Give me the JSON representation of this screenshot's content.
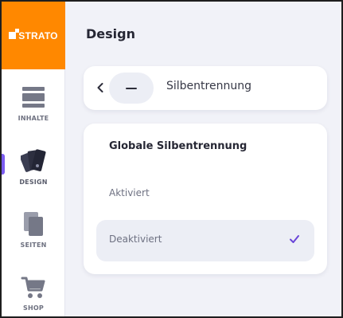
{
  "brand": {
    "name": "STRATO",
    "color": "#ff8800"
  },
  "sidebar": {
    "items": [
      {
        "label": "INHALTE",
        "icon": "content-blocks-icon",
        "active": false
      },
      {
        "label": "DESIGN",
        "icon": "design-swatches-icon",
        "active": true
      },
      {
        "label": "SEITEN",
        "icon": "pages-icon",
        "active": false
      },
      {
        "label": "SHOP",
        "icon": "shopping-cart-icon",
        "active": false
      }
    ],
    "accent": "#7b5cf0"
  },
  "main": {
    "title": "Design",
    "nav_card": {
      "back_icon": "chevron-left-icon",
      "section_icon": "hyphen-icon",
      "section_name": "Silbentrennung"
    },
    "options_card": {
      "heading": "Globale Silbentrennung",
      "options": [
        {
          "label": "Aktiviert",
          "selected": false
        },
        {
          "label": "Deaktiviert",
          "selected": true
        }
      ],
      "check_icon": "checkmark-icon",
      "check_color": "#6a45d8"
    }
  }
}
